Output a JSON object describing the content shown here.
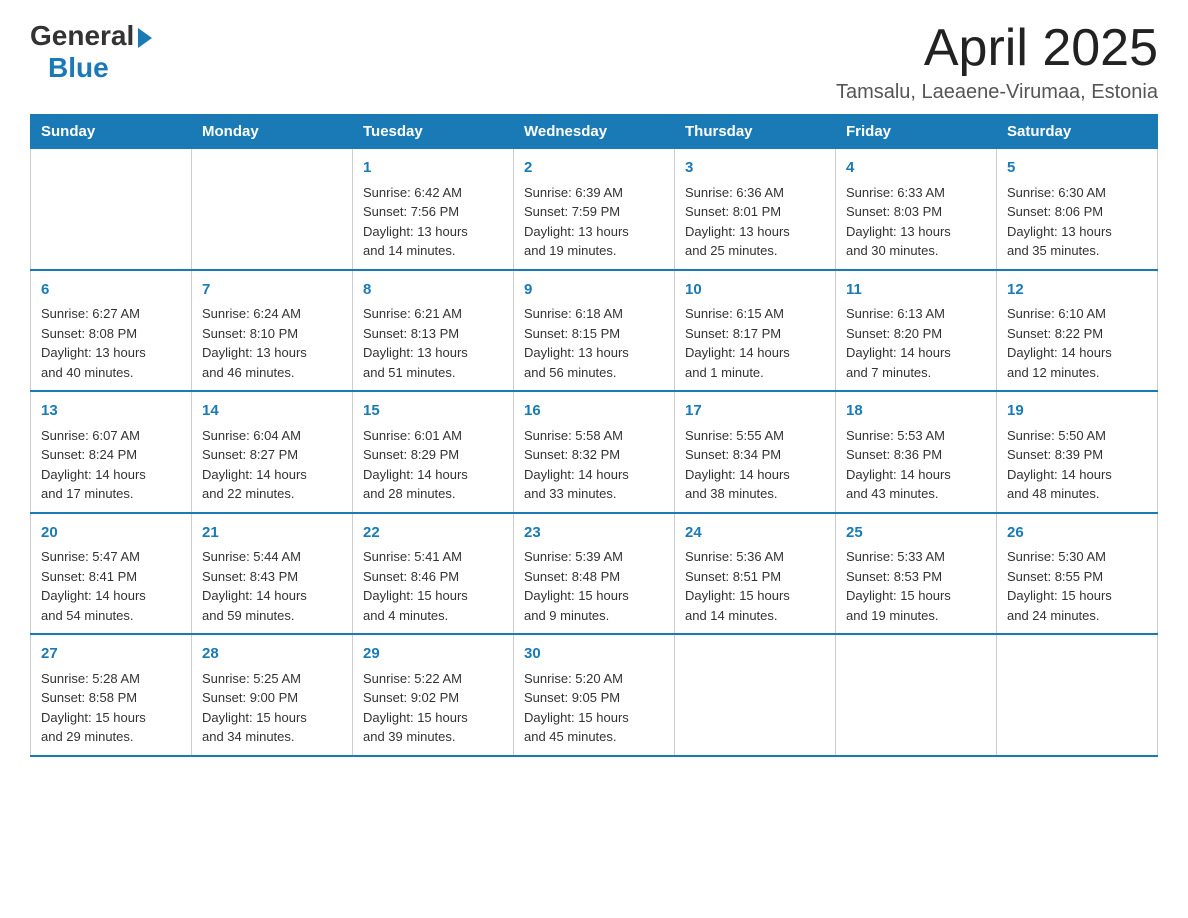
{
  "logo": {
    "general": "General",
    "blue": "Blue"
  },
  "title": "April 2025",
  "location": "Tamsalu, Laeaene-Virumaa, Estonia",
  "days_of_week": [
    "Sunday",
    "Monday",
    "Tuesday",
    "Wednesday",
    "Thursday",
    "Friday",
    "Saturday"
  ],
  "weeks": [
    [
      {
        "day": "",
        "info": ""
      },
      {
        "day": "",
        "info": ""
      },
      {
        "day": "1",
        "info": "Sunrise: 6:42 AM\nSunset: 7:56 PM\nDaylight: 13 hours\nand 14 minutes."
      },
      {
        "day": "2",
        "info": "Sunrise: 6:39 AM\nSunset: 7:59 PM\nDaylight: 13 hours\nand 19 minutes."
      },
      {
        "day": "3",
        "info": "Sunrise: 6:36 AM\nSunset: 8:01 PM\nDaylight: 13 hours\nand 25 minutes."
      },
      {
        "day": "4",
        "info": "Sunrise: 6:33 AM\nSunset: 8:03 PM\nDaylight: 13 hours\nand 30 minutes."
      },
      {
        "day": "5",
        "info": "Sunrise: 6:30 AM\nSunset: 8:06 PM\nDaylight: 13 hours\nand 35 minutes."
      }
    ],
    [
      {
        "day": "6",
        "info": "Sunrise: 6:27 AM\nSunset: 8:08 PM\nDaylight: 13 hours\nand 40 minutes."
      },
      {
        "day": "7",
        "info": "Sunrise: 6:24 AM\nSunset: 8:10 PM\nDaylight: 13 hours\nand 46 minutes."
      },
      {
        "day": "8",
        "info": "Sunrise: 6:21 AM\nSunset: 8:13 PM\nDaylight: 13 hours\nand 51 minutes."
      },
      {
        "day": "9",
        "info": "Sunrise: 6:18 AM\nSunset: 8:15 PM\nDaylight: 13 hours\nand 56 minutes."
      },
      {
        "day": "10",
        "info": "Sunrise: 6:15 AM\nSunset: 8:17 PM\nDaylight: 14 hours\nand 1 minute."
      },
      {
        "day": "11",
        "info": "Sunrise: 6:13 AM\nSunset: 8:20 PM\nDaylight: 14 hours\nand 7 minutes."
      },
      {
        "day": "12",
        "info": "Sunrise: 6:10 AM\nSunset: 8:22 PM\nDaylight: 14 hours\nand 12 minutes."
      }
    ],
    [
      {
        "day": "13",
        "info": "Sunrise: 6:07 AM\nSunset: 8:24 PM\nDaylight: 14 hours\nand 17 minutes."
      },
      {
        "day": "14",
        "info": "Sunrise: 6:04 AM\nSunset: 8:27 PM\nDaylight: 14 hours\nand 22 minutes."
      },
      {
        "day": "15",
        "info": "Sunrise: 6:01 AM\nSunset: 8:29 PM\nDaylight: 14 hours\nand 28 minutes."
      },
      {
        "day": "16",
        "info": "Sunrise: 5:58 AM\nSunset: 8:32 PM\nDaylight: 14 hours\nand 33 minutes."
      },
      {
        "day": "17",
        "info": "Sunrise: 5:55 AM\nSunset: 8:34 PM\nDaylight: 14 hours\nand 38 minutes."
      },
      {
        "day": "18",
        "info": "Sunrise: 5:53 AM\nSunset: 8:36 PM\nDaylight: 14 hours\nand 43 minutes."
      },
      {
        "day": "19",
        "info": "Sunrise: 5:50 AM\nSunset: 8:39 PM\nDaylight: 14 hours\nand 48 minutes."
      }
    ],
    [
      {
        "day": "20",
        "info": "Sunrise: 5:47 AM\nSunset: 8:41 PM\nDaylight: 14 hours\nand 54 minutes."
      },
      {
        "day": "21",
        "info": "Sunrise: 5:44 AM\nSunset: 8:43 PM\nDaylight: 14 hours\nand 59 minutes."
      },
      {
        "day": "22",
        "info": "Sunrise: 5:41 AM\nSunset: 8:46 PM\nDaylight: 15 hours\nand 4 minutes."
      },
      {
        "day": "23",
        "info": "Sunrise: 5:39 AM\nSunset: 8:48 PM\nDaylight: 15 hours\nand 9 minutes."
      },
      {
        "day": "24",
        "info": "Sunrise: 5:36 AM\nSunset: 8:51 PM\nDaylight: 15 hours\nand 14 minutes."
      },
      {
        "day": "25",
        "info": "Sunrise: 5:33 AM\nSunset: 8:53 PM\nDaylight: 15 hours\nand 19 minutes."
      },
      {
        "day": "26",
        "info": "Sunrise: 5:30 AM\nSunset: 8:55 PM\nDaylight: 15 hours\nand 24 minutes."
      }
    ],
    [
      {
        "day": "27",
        "info": "Sunrise: 5:28 AM\nSunset: 8:58 PM\nDaylight: 15 hours\nand 29 minutes."
      },
      {
        "day": "28",
        "info": "Sunrise: 5:25 AM\nSunset: 9:00 PM\nDaylight: 15 hours\nand 34 minutes."
      },
      {
        "day": "29",
        "info": "Sunrise: 5:22 AM\nSunset: 9:02 PM\nDaylight: 15 hours\nand 39 minutes."
      },
      {
        "day": "30",
        "info": "Sunrise: 5:20 AM\nSunset: 9:05 PM\nDaylight: 15 hours\nand 45 minutes."
      },
      {
        "day": "",
        "info": ""
      },
      {
        "day": "",
        "info": ""
      },
      {
        "day": "",
        "info": ""
      }
    ]
  ]
}
